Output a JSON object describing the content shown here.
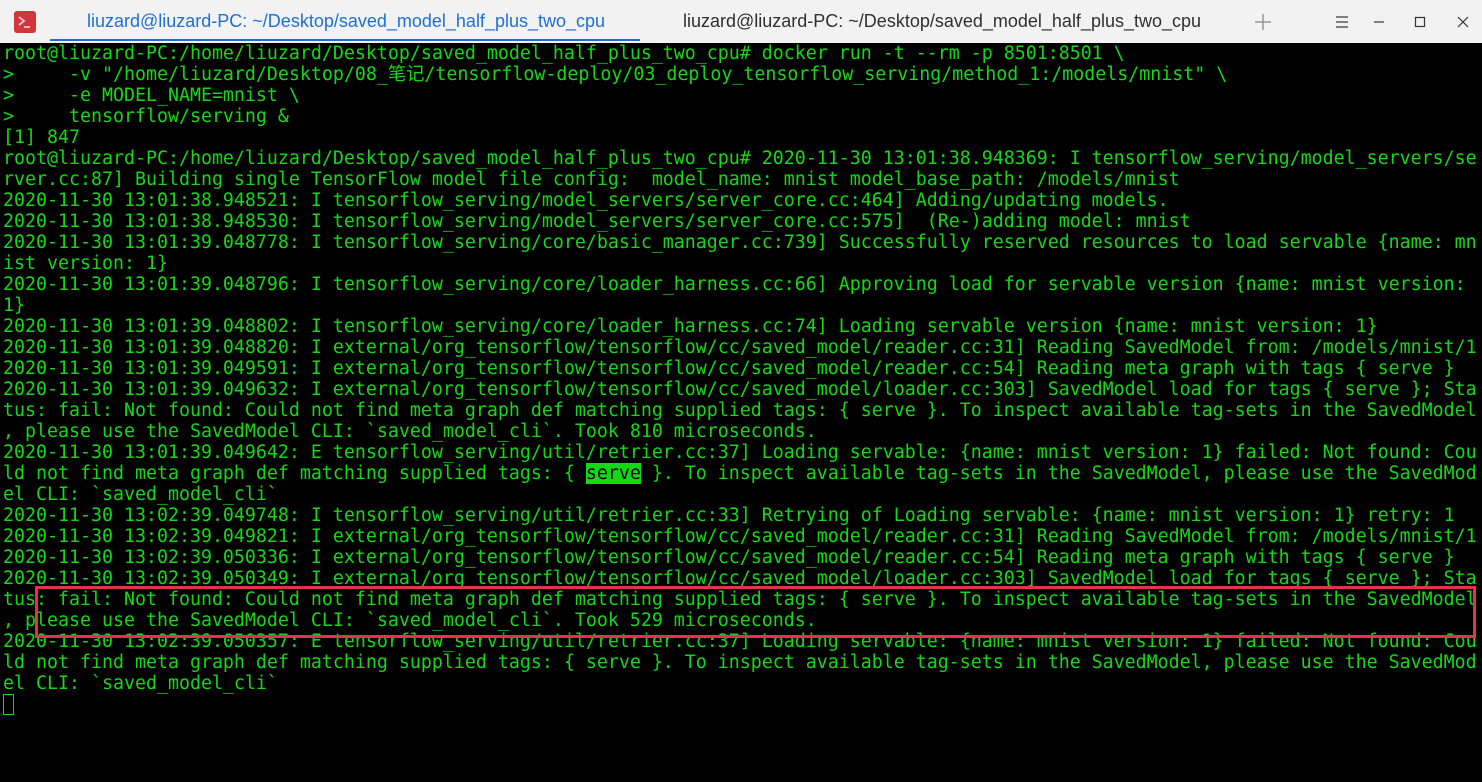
{
  "window": {
    "tabs": [
      {
        "label": "liuzard@liuzard-PC: ~/Desktop/saved_model_half_plus_two_cpu",
        "active": true
      },
      {
        "label": "liuzard@liuzard-PC: ~/Desktop/saved_model_half_plus_two_cpu",
        "active": false
      }
    ],
    "icons": {
      "app": "terminal-icon",
      "new_tab": "plus-icon",
      "menu": "menu-icon",
      "minimize": "minimize-icon",
      "maximize": "maximize-icon",
      "close": "close-icon"
    }
  },
  "colors": {
    "terminal_background": "#000000",
    "terminal_text": "#14d814",
    "active_tab": "#1f6fd6",
    "titlebar_background": "#f2f2f2",
    "annotation_box": "#e6304c",
    "match_highlight": "#14d814"
  },
  "terminal": {
    "lines": [
      "root@liuzard-PC:/home/liuzard/Desktop/saved_model_half_plus_two_cpu# docker run -t --rm -p 8501:8501 \\",
      ">     -v \"/home/liuzard/Desktop/08_笔记/tensorflow-deploy/03_deploy_tensorflow_serving/method_1:/models/mnist\" \\",
      ">     -e MODEL_NAME=mnist \\",
      ">     tensorflow/serving &",
      "[1] 847",
      "root@liuzard-PC:/home/liuzard/Desktop/saved_model_half_plus_two_cpu# 2020-11-30 13:01:38.948369: I tensorflow_serving/model_servers/se",
      "rver.cc:87] Building single TensorFlow model file config:  model_name: mnist model_base_path: /models/mnist",
      "2020-11-30 13:01:38.948521: I tensorflow_serving/model_servers/server_core.cc:464] Adding/updating models.",
      "2020-11-30 13:01:38.948530: I tensorflow_serving/model_servers/server_core.cc:575]  (Re-)adding model: mnist",
      "2020-11-30 13:01:39.048778: I tensorflow_serving/core/basic_manager.cc:739] Successfully reserved resources to load servable {name: mn",
      "ist version: 1}",
      "2020-11-30 13:01:39.048796: I tensorflow_serving/core/loader_harness.cc:66] Approving load for servable version {name: mnist version:",
      "1}",
      "2020-11-30 13:01:39.048802: I tensorflow_serving/core/loader_harness.cc:74] Loading servable version {name: mnist version: 1}",
      "2020-11-30 13:01:39.048820: I external/org_tensorflow/tensorflow/cc/saved_model/reader.cc:31] Reading SavedModel from: /models/mnist/1",
      "2020-11-30 13:01:39.049591: I external/org_tensorflow/tensorflow/cc/saved_model/reader.cc:54] Reading meta graph with tags { serve }",
      "2020-11-30 13:01:39.049632: I external/org_tensorflow/tensorflow/cc/saved_model/loader.cc:303] SavedModel load for tags { serve }; Sta",
      "tus: fail: Not found: Could not find meta graph def matching supplied tags: { serve }. To inspect available tag-sets in the SavedModel",
      ", please use the SavedModel CLI: `saved_model_cli`. Took 810 microseconds.",
      "2020-11-30 13:01:39.049642: E tensorflow_serving/util/retrier.cc:37] Loading servable: {name: mnist version: 1} failed: Not found: Cou",
      {
        "before": "ld not find meta graph def matching supplied tags: { ",
        "match": "serve",
        "after": " }. To inspect available tag-sets in the SavedModel, please use the SavedMod"
      },
      "el CLI: `saved_model_cli`",
      "2020-11-30 13:02:39.049748: I tensorflow_serving/util/retrier.cc:33] Retrying of Loading servable: {name: mnist version: 1} retry: 1",
      "2020-11-30 13:02:39.049821: I external/org_tensorflow/tensorflow/cc/saved_model/reader.cc:31] Reading SavedModel from: /models/mnist/1",
      "2020-11-30 13:02:39.050336: I external/org_tensorflow/tensorflow/cc/saved_model/reader.cc:54] Reading meta graph with tags { serve }",
      "2020-11-30 13:02:39.050349: I external/org_tensorflow/tensorflow/cc/saved_model/loader.cc:303] SavedModel load for tags { serve }; Sta",
      "tus: fail: Not found: Could not find meta graph def matching supplied tags: { serve }. To inspect available tag-sets in the SavedModel",
      ", please use the SavedModel CLI: `saved_model_cli`. Took 529 microseconds.",
      "2020-11-30 13:02:39.050357: E tensorflow_serving/util/retrier.cc:37] Loading servable: {name: mnist version: 1} failed: Not found: Cou",
      "ld not find meta graph def matching supplied tags: { serve }. To inspect available tag-sets in the SavedModel, please use the SavedMod",
      "el CLI: `saved_model_cli`"
    ]
  }
}
